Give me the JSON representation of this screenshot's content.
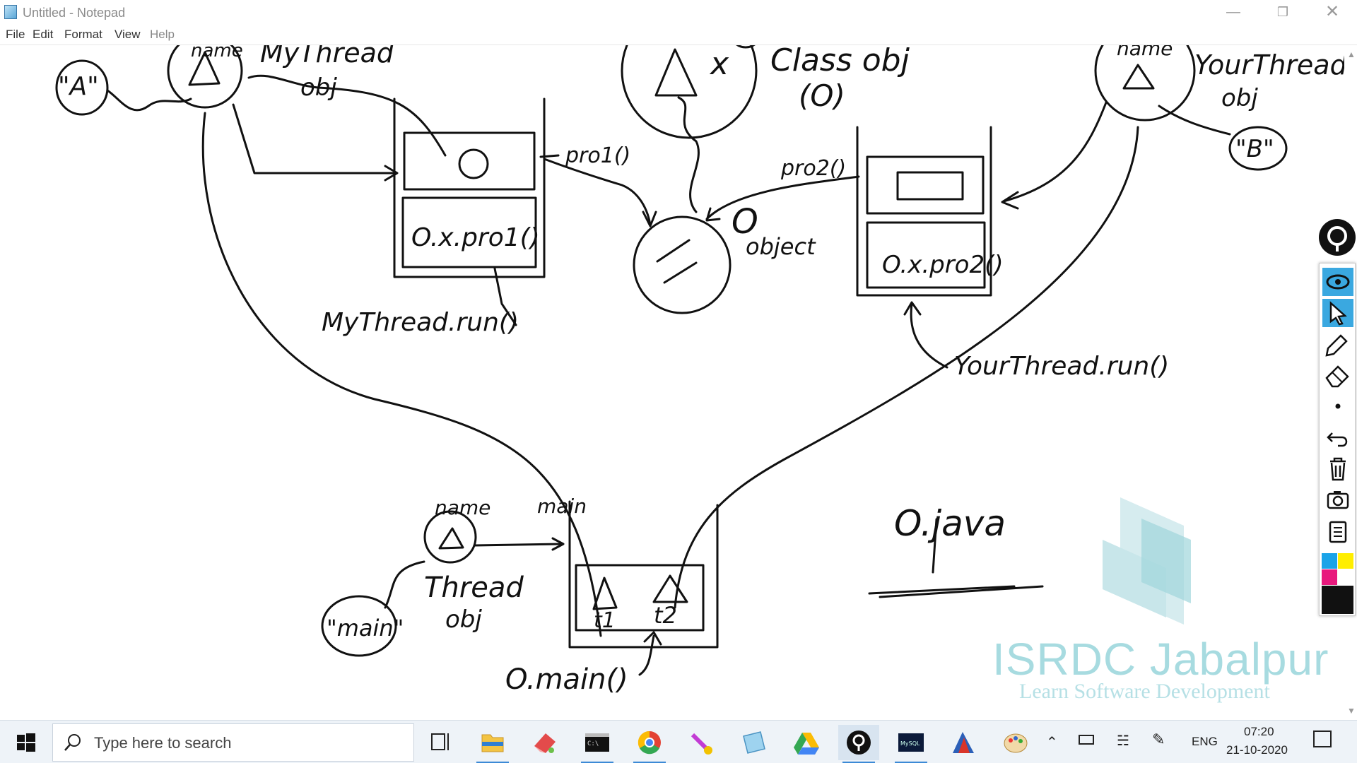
{
  "window": {
    "title": "Untitled - Notepad",
    "menu": [
      "File",
      "Edit",
      "Format",
      "View",
      "Help"
    ]
  },
  "drawing": {
    "mythread": {
      "label": "MyThread",
      "obj": "obj",
      "name": "name",
      "arg": "\"A\"",
      "method": "pro1()",
      "call": "O.x.pro1()",
      "run": "MyThread.run()"
    },
    "classobj": {
      "label": "Class obj",
      "sub": "(O)",
      "field": "x"
    },
    "object": {
      "label": "object",
      "letter": "O"
    },
    "yourthread": {
      "label": "YourThread",
      "obj": "obj",
      "name": "name",
      "arg": "\"B\"",
      "method": "pro2()",
      "call": "O.x.pro2()",
      "run": "YourThread.run()"
    },
    "mainthread": {
      "label": "Thread",
      "obj": "obj",
      "name": "name",
      "arg": "\"main\"",
      "stack": "main",
      "t1": "t1",
      "t2": "t2",
      "run": "O.main()"
    },
    "file": "O.java"
  },
  "watermark": {
    "title": "ISRDC Jabalpur",
    "subtitle": "Learn Software Development"
  },
  "pen_toolbar": {
    "tools": [
      "eye-icon",
      "pointer-icon",
      "pen-icon",
      "eraser-icon",
      "dot-icon",
      "undo-icon",
      "trash-icon",
      "camera-icon",
      "clipboard-icon"
    ],
    "colors": [
      "#1aa3e8",
      "#ffee00",
      "#e8197d",
      "#111111"
    ]
  },
  "taskbar": {
    "search_placeholder": "Type here to search",
    "apps": [
      "task-view-icon",
      "file-explorer-icon",
      "app-icon",
      "terminal-icon",
      "chrome-icon",
      "app-icon",
      "app-icon",
      "drive-icon",
      "pen-app-icon",
      "mysql-icon",
      "app-icon",
      "paint-icon"
    ],
    "language": "ENG",
    "time": "07:20",
    "date": "21-10-2020"
  },
  "colors": {
    "accent": "#3aa8e0",
    "taskbar": "#eef3f8",
    "ink": "#111111",
    "watermark": "#a7dbe0"
  }
}
